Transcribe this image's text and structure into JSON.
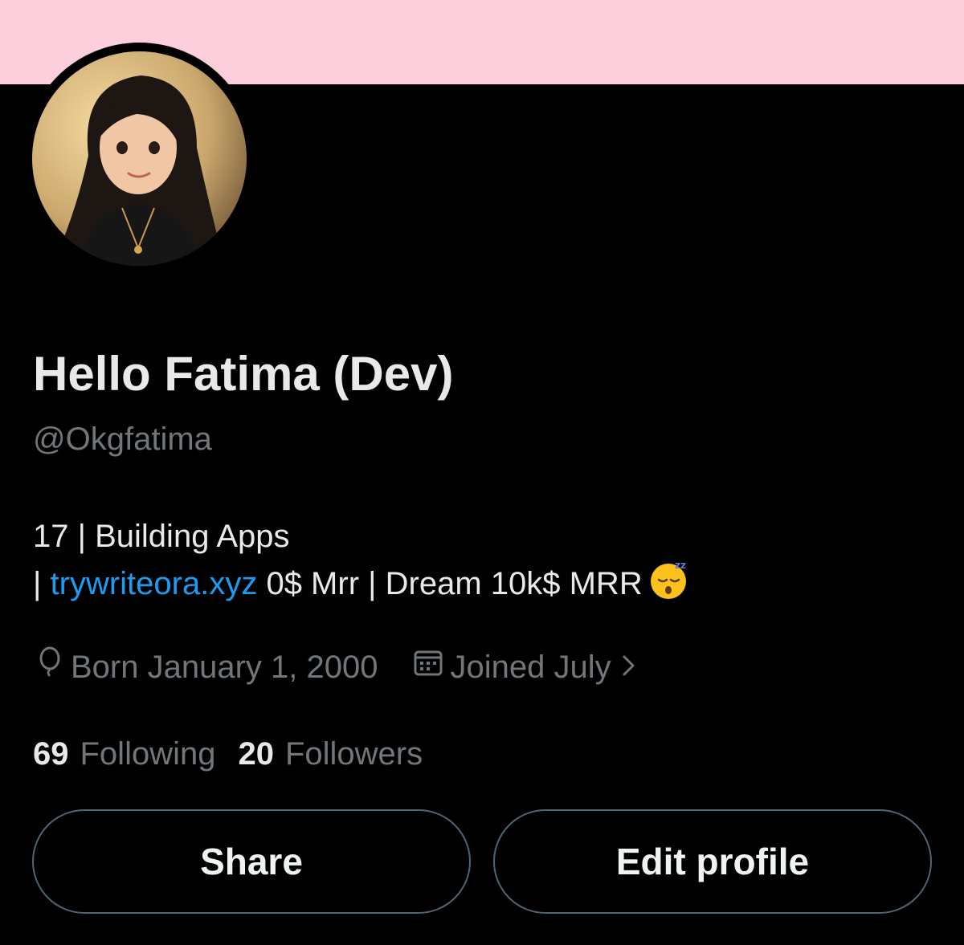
{
  "profile": {
    "display_name": "Hello Fatima (Dev)",
    "handle": "@Okgfatima",
    "avatar_alt": "profile-avatar-illustration"
  },
  "bio": {
    "line1": "17 | Building Apps",
    "line2_prefix": "| ",
    "link_text": "trywriteora.xyz",
    "line2_suffix": " 0$ Mrr | Dream 10k$ MRR",
    "emoji": "sleeping-face-emoji"
  },
  "meta": {
    "birthday": "Born January 1, 2000",
    "joined": "Joined July",
    "birthday_icon": "balloon-icon",
    "joined_icon": "calendar-icon"
  },
  "stats": {
    "following_count": "69",
    "following_label": "Following",
    "followers_count": "20",
    "followers_label": "Followers"
  },
  "buttons": {
    "share": "Share",
    "edit_profile": "Edit profile"
  },
  "colors": {
    "background": "#000000",
    "banner": "#fdcfdd",
    "primary_text": "#e7e9ea",
    "secondary_text": "#71767b",
    "link": "#1d9bf0",
    "button_border": "#536471"
  }
}
